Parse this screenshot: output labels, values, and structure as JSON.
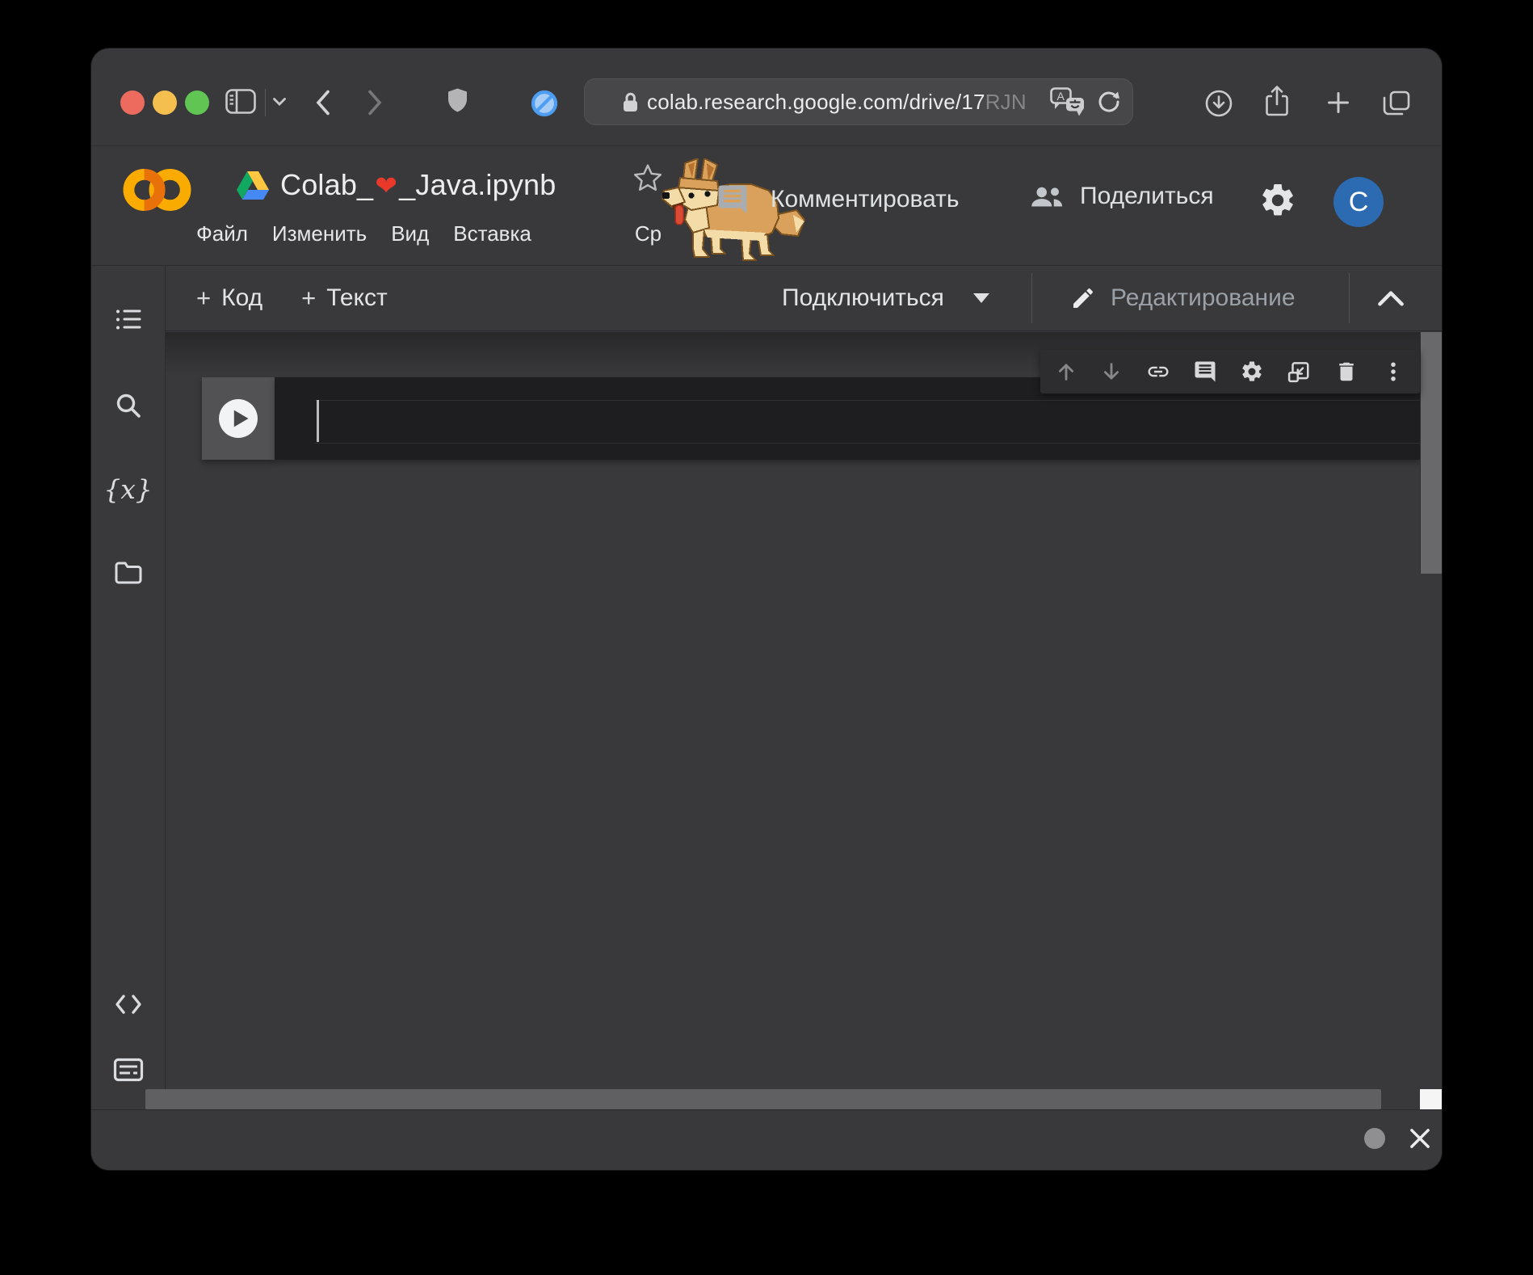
{
  "browser": {
    "url_main": "colab.research.google.com/drive/17",
    "url_faded": "RJN"
  },
  "colab": {
    "header": {
      "title_pre": "Colab_",
      "title_heart": "❤",
      "title_post": "_Java.ipynb",
      "comment_label": "Комментировать",
      "share_label": "Поделиться",
      "avatar_letter": "C",
      "menu_items": [
        {
          "id": "file",
          "label": "Файл"
        },
        {
          "id": "edit",
          "label": "Изменить"
        },
        {
          "id": "view",
          "label": "Вид"
        },
        {
          "id": "insert",
          "label": "Вставка"
        },
        {
          "id": "runtime",
          "label": "Ср"
        }
      ]
    },
    "toolbar": {
      "add_code": {
        "plus": "+",
        "label": "Код"
      },
      "add_text": {
        "plus": "+",
        "label": "Текст"
      },
      "connect_label": "Подключиться",
      "edit_mode_label": "Редактирование"
    },
    "sidebar": {
      "variables_glyph": "{x}",
      "icon_names": [
        "table-of-contents",
        "search",
        "variables",
        "files",
        "code-snippets",
        "terminal"
      ]
    },
    "cell": {
      "code": ""
    },
    "cell_toolbar_icon_names": [
      "move-cell-up",
      "move-cell-down",
      "copy-link-to-cell",
      "add-comment",
      "cell-settings",
      "mirror-cell-in-tab",
      "delete-cell",
      "more-actions"
    ]
  },
  "icons": {
    "translate_letter": "A",
    "blocked_badge": "circle-with-slash",
    "shield_badge": "shield",
    "corgi": "walking-corgi-easter-egg"
  },
  "colors": {
    "window_bg": "#39393b",
    "editor_bg": "#1e1e20",
    "accent_avatar_blue": "#2c6bb2",
    "heart_red": "#e8392b",
    "traffic_red": "#ec6a5e",
    "traffic_yellow": "#f5bf4f",
    "traffic_green": "#61c554",
    "blocked_blue": "#4d9df2",
    "logo_orange": "#f9ab00",
    "logo_orange_dark": "#e8710a",
    "drive_green": "#11a861",
    "drive_yellow": "#ffc63f",
    "drive_blue": "#4688f4",
    "dim_text": "#9aa0a6"
  }
}
